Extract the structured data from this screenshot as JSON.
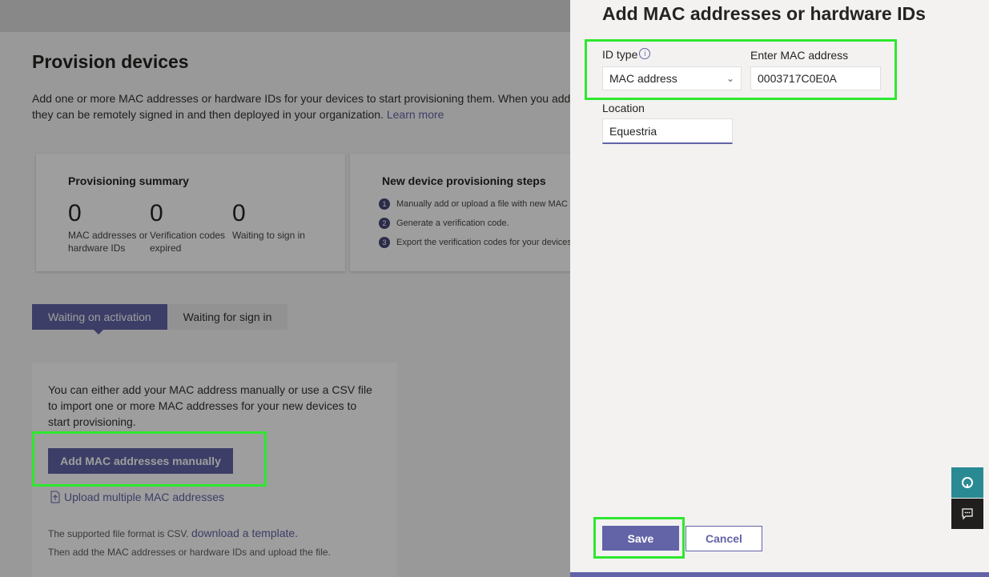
{
  "page": {
    "title": "Provision devices",
    "intro_text": "Add one or more MAC addresses or hardware IDs for your devices to start provisioning them. When you add",
    "intro_text_2": "they can be remotely signed in and then deployed in your organization.",
    "learn_more": "Learn more"
  },
  "summary": {
    "title": "Provisioning summary",
    "stats": [
      {
        "value": "0",
        "label": "MAC addresses or hardware IDs"
      },
      {
        "value": "0",
        "label": "Verification codes expired"
      },
      {
        "value": "0",
        "label": "Waiting to sign in"
      }
    ]
  },
  "steps": {
    "title": "New device provisioning steps",
    "items": [
      {
        "num": "1",
        "text": "Manually add or upload a file with new MAC"
      },
      {
        "num": "2",
        "text": "Generate a verification code."
      },
      {
        "num": "3",
        "text": "Export the verification codes for your devices"
      }
    ]
  },
  "tabs": [
    {
      "label": "Waiting on activation",
      "active": true
    },
    {
      "label": "Waiting for sign in",
      "active": false
    }
  ],
  "panel": {
    "text": "You can either add your MAC address manually or use a CSV file to import one or more MAC addresses for your new devices to start provisioning.",
    "add_manual": "Add MAC addresses manually",
    "upload_multiple": "Upload multiple MAC addresses",
    "note1_prefix": "The supported file format is CSV.",
    "note1_link": "download a template.",
    "note2": "Then add the MAC addresses or hardware IDs and upload the file."
  },
  "drawer": {
    "title": "Add MAC addresses or hardware IDs",
    "id_type_label": "ID type",
    "id_type_value": "MAC address",
    "mac_label": "Enter MAC address",
    "mac_value": "0003717C0E0A",
    "location_label": "Location",
    "location_value": "Equestria",
    "save": "Save",
    "cancel": "Cancel"
  },
  "colors": {
    "accent": "#6264a7",
    "highlight": "#2ee82e"
  },
  "icons": {
    "info": "info-icon",
    "chevron": "chevron-down-icon",
    "upload": "upload-file-icon",
    "help": "help-icon",
    "feedback": "feedback-icon"
  }
}
